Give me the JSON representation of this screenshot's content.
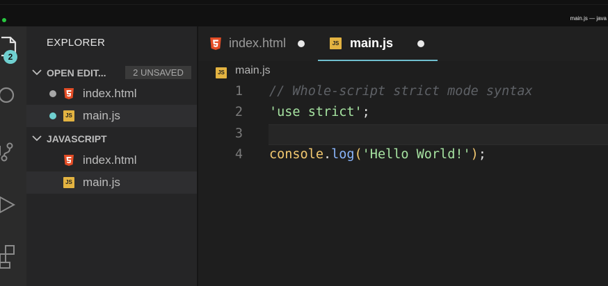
{
  "window": {
    "title": "main.js — java"
  },
  "activity_bar": {
    "badge": "2"
  },
  "sidebar": {
    "title": "EXPLORER",
    "open_editors": {
      "label": "OPEN EDIT...",
      "unsaved_badge": "2 UNSAVED",
      "files": [
        {
          "name": "index.html",
          "icon": "html5-icon",
          "dot_color": "#a8a8a8"
        },
        {
          "name": "main.js",
          "icon": "javascript-icon",
          "dot_color": "#6fd0d0"
        }
      ]
    },
    "folder": {
      "label": "JAVASCRIPT",
      "files": [
        {
          "name": "index.html",
          "icon": "html5-icon"
        },
        {
          "name": "main.js",
          "icon": "javascript-icon"
        }
      ]
    }
  },
  "tabs": [
    {
      "label": "index.html",
      "icon": "html5-icon",
      "modified": true,
      "active": false
    },
    {
      "label": "main.js",
      "icon": "javascript-icon",
      "modified": true,
      "active": true
    }
  ],
  "breadcrumb": {
    "file": "main.js",
    "icon": "javascript-icon"
  },
  "editor": {
    "lines": [
      {
        "number": "1",
        "comment": "// Whole-script strict mode syntax"
      },
      {
        "number": "2",
        "string": "'use strict'",
        "semicolon": ";"
      },
      {
        "number": "3"
      },
      {
        "number": "4",
        "object": "console",
        "dot": ".",
        "method": "log",
        "open_paren": "(",
        "string": "'Hello World!'",
        "close_paren": ")",
        "semicolon": ";"
      }
    ]
  },
  "colors": {
    "html_icon": "#e44d26",
    "js_icon": "#e3b341",
    "accent": "#6fbfcf",
    "string": "#a6e3a1",
    "comment": "#5e6166"
  }
}
